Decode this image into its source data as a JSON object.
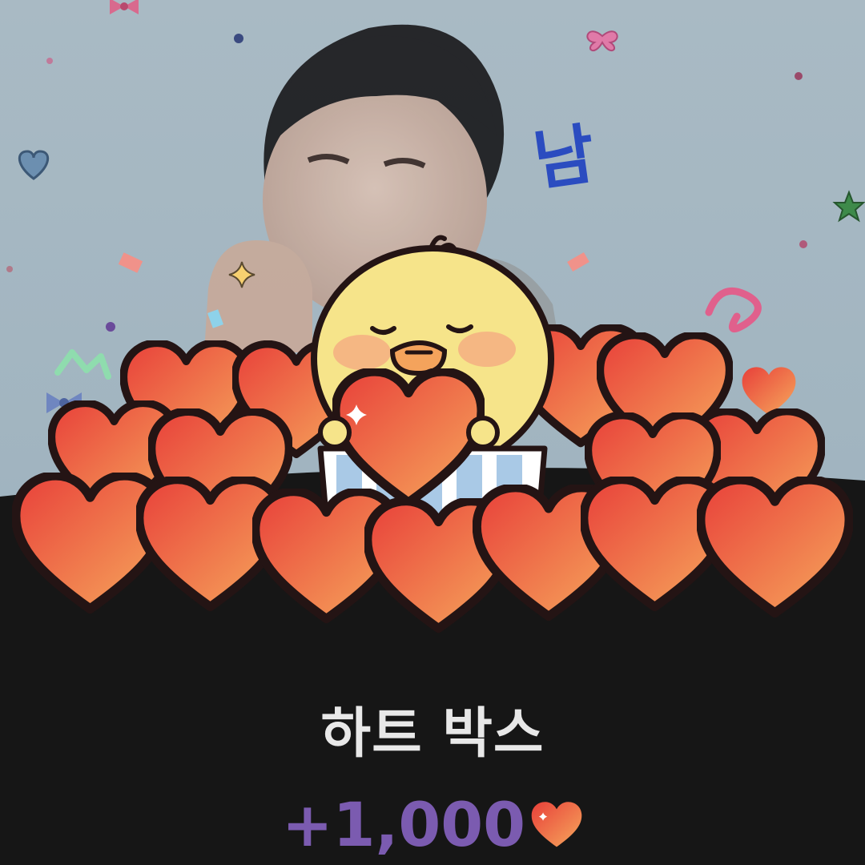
{
  "background": {
    "profile_sticker_text": "남",
    "profile_sticker_color": "#2b4cc0",
    "sky_color": "#a7b8c2",
    "panel_color": "#161616"
  },
  "gift_illustration": {
    "mascot": "yellow-chick-icon",
    "held_item": "heart-icon",
    "container": "gift-box-icon",
    "heart_colors": [
      "#e8483c",
      "#f5a25a"
    ]
  },
  "reward": {
    "title": "하트 박스",
    "amount": "+1,000",
    "amount_color": "#7b5bb0",
    "currency_icon": "heart-icon"
  }
}
